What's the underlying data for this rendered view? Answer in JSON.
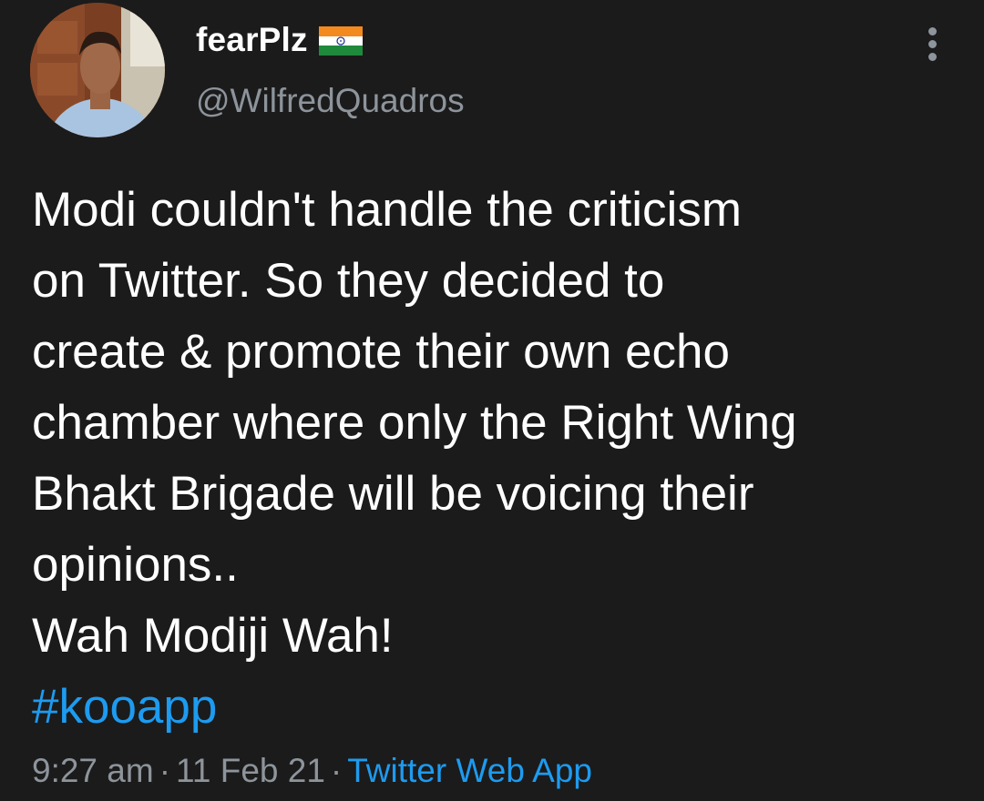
{
  "author": {
    "display_name": "fearPlz",
    "handle": "@WilfredQuadros",
    "avatar": "avatar-photo",
    "flag_icon": "india-flag-icon"
  },
  "more_icon": "more-vertical-icon",
  "tweet": {
    "lines": [
      "Modi couldn't handle the criticism",
      "on Twitter. So they decided to",
      "create & promote their own echo",
      "chamber where only the Right Wing",
      "Bhakt Brigade will be voicing their",
      "opinions..",
      "Wah Modiji Wah!"
    ],
    "hashtag": "#kooapp"
  },
  "meta": {
    "time": "9:27 am",
    "separator": "·",
    "date": "11 Feb 21",
    "source": "Twitter Web App"
  },
  "colors": {
    "background": "#1b1b1b",
    "text": "#ffffff",
    "secondary_text": "#8d949b",
    "link": "#1d9bf0"
  }
}
